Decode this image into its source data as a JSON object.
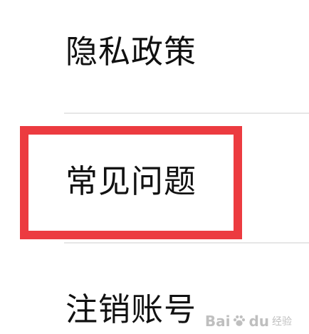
{
  "menu": {
    "items": [
      {
        "label": "隐私政策"
      },
      {
        "label": "常见问题"
      },
      {
        "label": "注销账号"
      }
    ]
  },
  "highlight": {
    "target": "常见问题",
    "color": "#ec3b40"
  },
  "watermark": {
    "brand": "Bai",
    "brand_suffix": "du",
    "sub": "经验",
    "icon": "paw-icon"
  }
}
